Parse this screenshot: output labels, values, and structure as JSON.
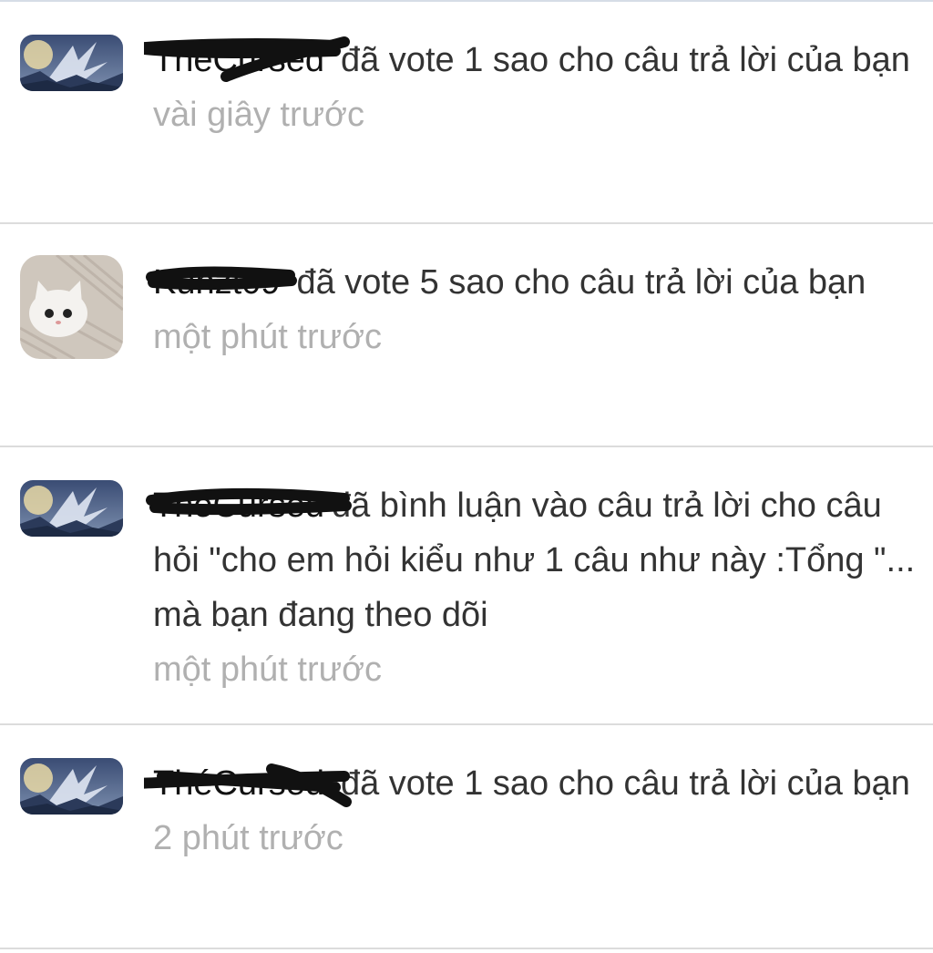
{
  "notifications": [
    {
      "user": "ThéCursed",
      "avatar_icon": "anime-sky-avatar-icon",
      "message": "đã vote 1 sao cho câu trả lời của bạn",
      "time": "vài giây trước"
    },
    {
      "user": "Kunzt09",
      "avatar_icon": "white-kitten-avatar-icon",
      "message": "đã vote 5 sao cho câu trả lời của bạn",
      "time": "một phút trước"
    },
    {
      "user": "ThéCursed",
      "avatar_icon": "anime-sky-avatar-icon",
      "message": "đã bình luận vào câu trả lời cho câu hỏi \"cho em hỏi kiểu như 1 câu như này :Tổng \"... mà bạn đang theo dõi",
      "time": "một phút trước"
    },
    {
      "user": "ThéCursed",
      "avatar_icon": "anime-sky-avatar-icon",
      "message": "đã vote 1 sao cho câu trả lời của bạn",
      "time": "2 phút trước"
    }
  ],
  "colors": {
    "text": "#333333",
    "time": "#b0b0b0",
    "divider": "#dcdcdc",
    "redaction": "#111111"
  }
}
